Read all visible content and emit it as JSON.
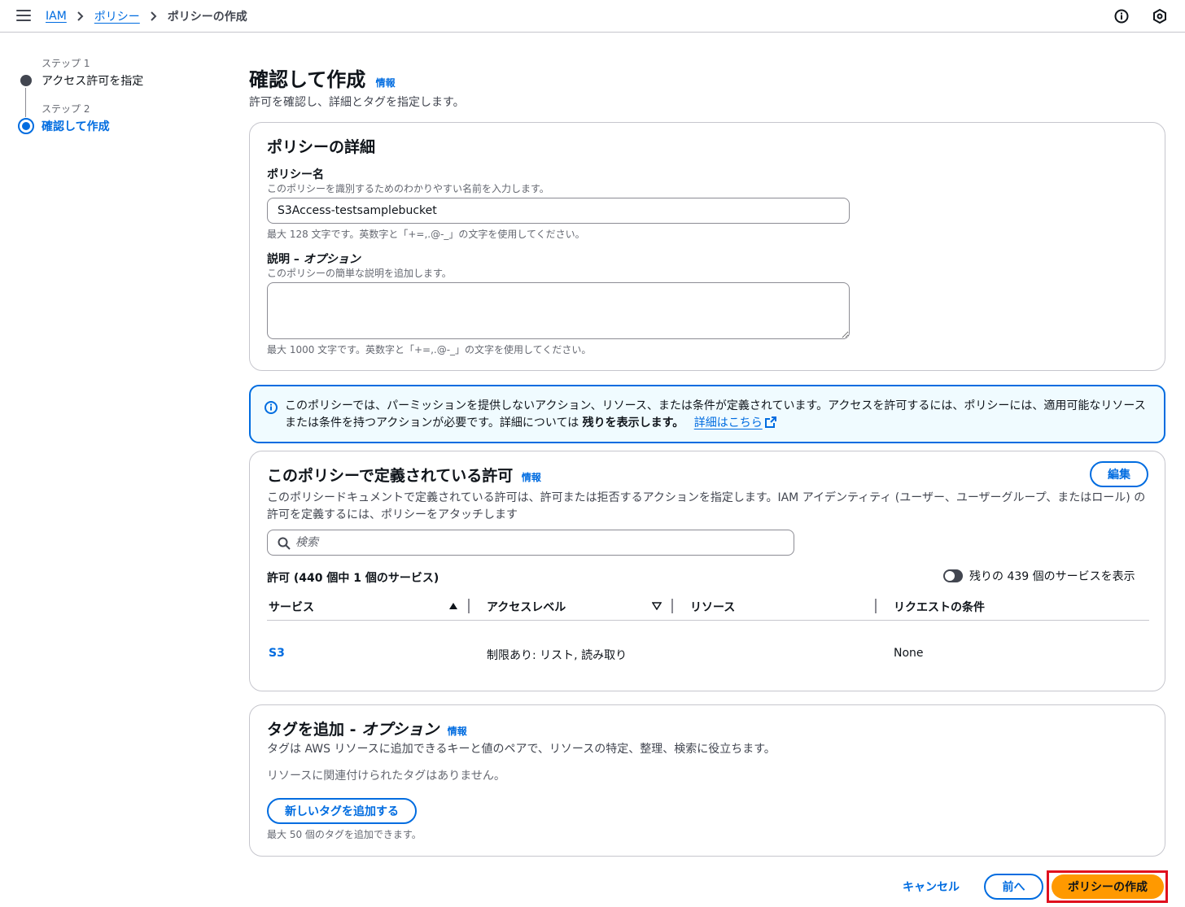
{
  "breadcrumb": {
    "items": [
      "IAM",
      "ポリシー"
    ],
    "current": "ポリシーの作成"
  },
  "steps": [
    {
      "label": "ステップ 1",
      "title": "アクセス許可を指定"
    },
    {
      "label": "ステップ 2",
      "title": "確認して作成"
    }
  ],
  "header": {
    "title": "確認して作成",
    "info": "情報",
    "description": "許可を確認し、詳細とタグを指定します。"
  },
  "details": {
    "title": "ポリシーの詳細",
    "name_label": "ポリシー名",
    "name_desc": "このポリシーを識別するためのわかりやすい名前を入力します。",
    "name_value": "S3Access-testsamplebucket",
    "name_hint": "最大 128 文字です。英数字と「+=,.@-_」の文字を使用してください。",
    "desc_label": "説明 – オプション",
    "desc_desc": "このポリシーの簡単な説明を追加します。",
    "desc_value": "",
    "desc_hint": "最大 1000 文字です。英数字と「+=,.@-_」の文字を使用してください。"
  },
  "alert": {
    "text": "このポリシーでは、パーミッションを提供しないアクション、リソース、または条件が定義されています。アクセスを許可するには、ポリシーには、適用可能なリソースまたは条件を持つアクションが必要です。詳細については ",
    "bold": "残りを表示します。",
    "link": "詳細はこちら"
  },
  "permissions": {
    "title": "このポリシーで定義されている許可",
    "info": "情報",
    "edit_label": "編集",
    "description": "このポリシードキュメントで定義されている許可は、許可または拒否するアクションを指定します。IAM アイデンティティ (ユーザー、ユーザーグループ、またはロール) の許可を定義するには、ポリシーをアタッチします",
    "search_placeholder": "検索",
    "count_label": "許可 (440 個中 1 個のサービス)",
    "toggle_label": "残りの 439 個のサービスを表示",
    "columns": [
      "サービス",
      "アクセスレベル",
      "リソース",
      "リクエストの条件"
    ],
    "rows": [
      {
        "service": "S3",
        "access_level": "制限あり: リスト, 読み取り",
        "resource": "",
        "condition": "None"
      }
    ]
  },
  "tags": {
    "title": "タグを追加 - ",
    "title_italic": "オプション",
    "info": "情報",
    "description": "タグは AWS リソースに追加できるキーと値のペアで、リソースの特定、整理、検索に役立ちます。",
    "empty": "リソースに関連付けられたタグはありません。",
    "add_button": "新しいタグを追加する",
    "hint": "最大 50 個のタグを追加できます。"
  },
  "footer": {
    "cancel": "キャンセル",
    "previous": "前へ",
    "create": "ポリシーの作成"
  },
  "colors": {
    "accent": "#006ce0",
    "primary_button": "#ff9900",
    "highlight_border": "#e0101e"
  }
}
